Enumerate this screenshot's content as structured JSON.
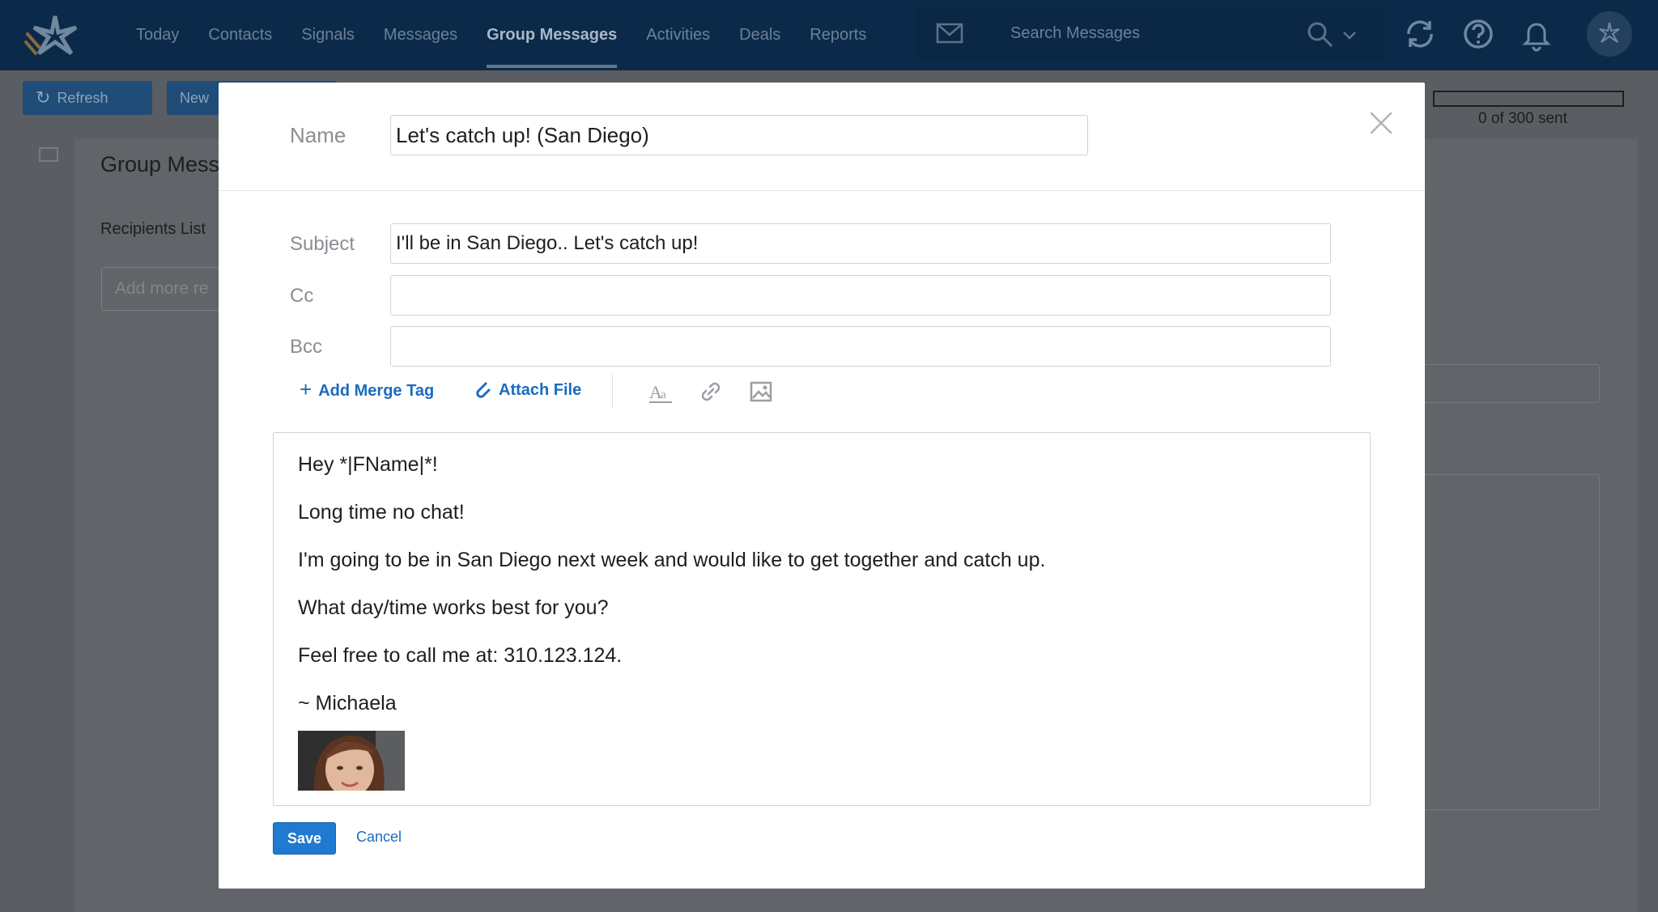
{
  "nav": {
    "items": [
      "Today",
      "Contacts",
      "Signals",
      "Messages",
      "Group Messages",
      "Activities",
      "Deals",
      "Reports"
    ],
    "active": "Group Messages"
  },
  "search": {
    "placeholder": "Search Messages"
  },
  "toolbar": {
    "refresh_label": "Refresh",
    "new_label": "New"
  },
  "page": {
    "title": "Group Mess",
    "recipients_label": "Recipients List",
    "add_placeholder": "Add more re",
    "sent_status": "0 of 300 sent",
    "sent_progress": 0
  },
  "modal": {
    "name_label": "Name",
    "name_value": "Let's catch up! (San Diego)",
    "subject_label": "Subject",
    "subject_value": "I'll be in San Diego.. Let's catch up!",
    "cc_label": "Cc",
    "cc_value": "",
    "bcc_label": "Bcc",
    "bcc_value": "",
    "add_merge_tag": "Add Merge Tag",
    "attach_file": "Attach File",
    "body_lines": [
      "Hey *|FName|*!",
      "Long time no chat!",
      "I'm going to be in San Diego next week and would like to get together and catch up.",
      "What day/time works best for you?",
      "Feel free to call me at: 310.123.124.",
      "~ Michaela"
    ],
    "save_label": "Save",
    "cancel_label": "Cancel"
  },
  "colors": {
    "topbar": "#0b2a4a",
    "accent": "#1f7ad0",
    "link": "#1a6cc0",
    "overlay": "#5a5d62"
  }
}
